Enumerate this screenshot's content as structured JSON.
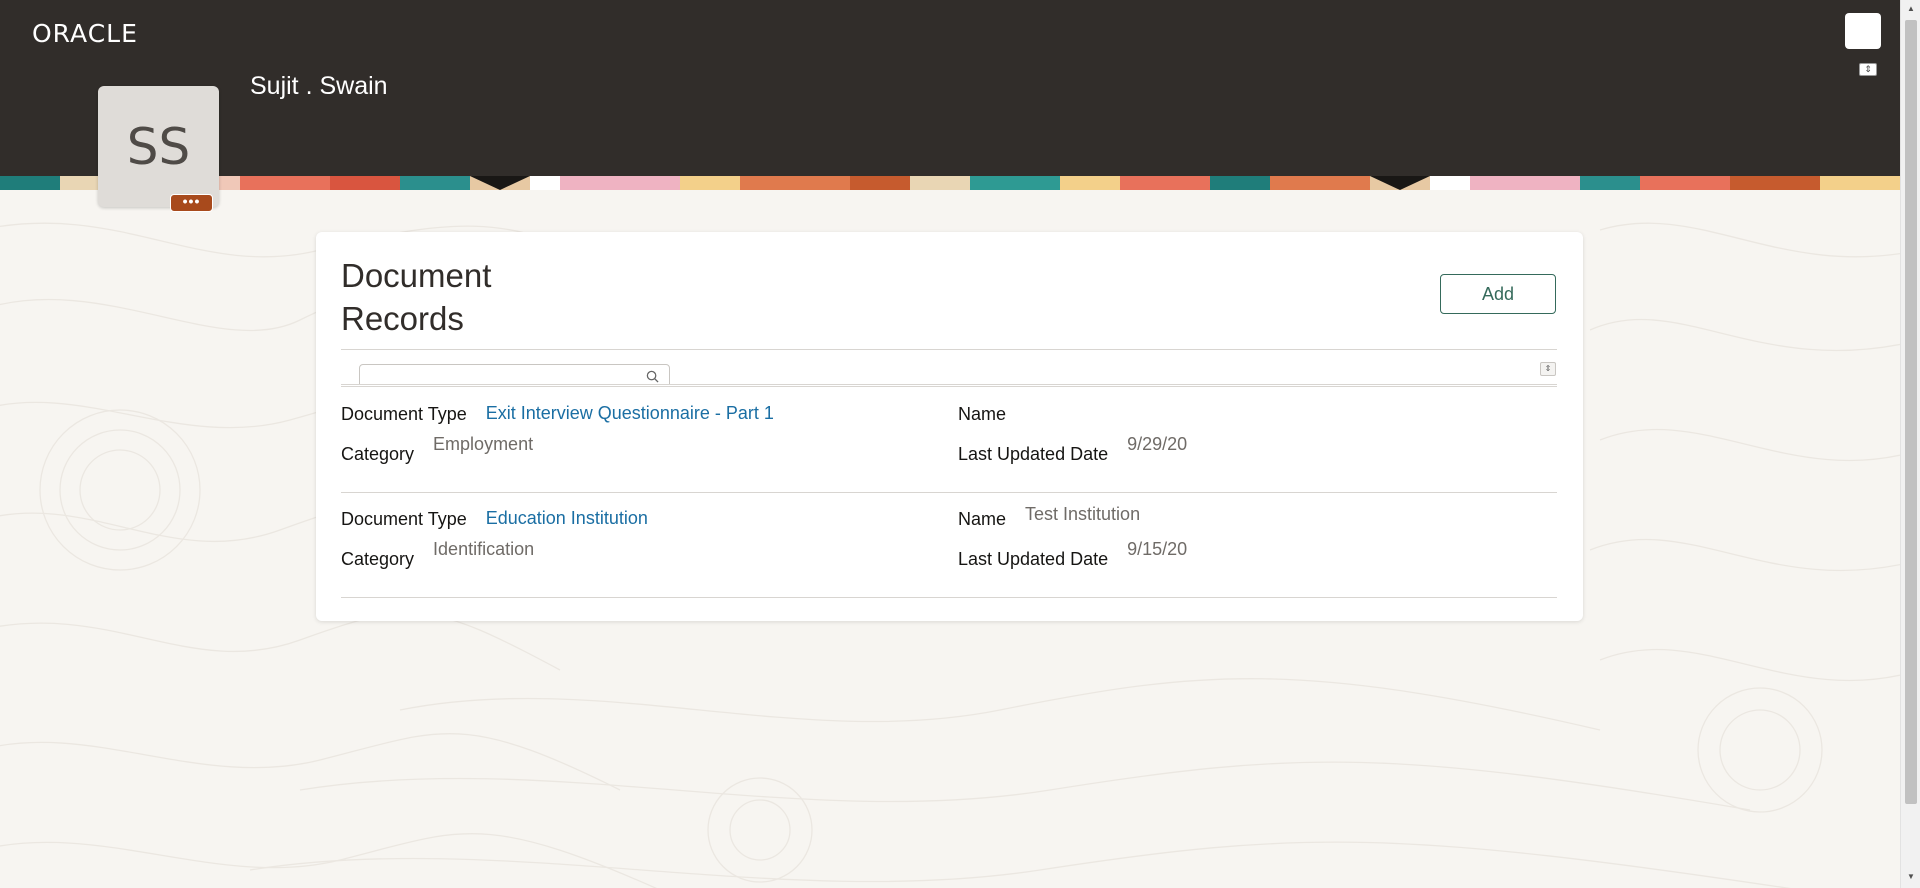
{
  "header": {
    "logo_text": "ORACLE",
    "person_name": "Sujit . Swain",
    "avatar_initials": "SS",
    "avatar_more_label": "•••"
  },
  "card": {
    "title_line1": "Document",
    "title_line2": "Records",
    "add_label": "Add"
  },
  "records": [
    {
      "document_type_label": "Document Type",
      "document_type": "Exit Interview Questionnaire - Part 1",
      "category_label": "Category",
      "category": "Employment",
      "name_label": "Name",
      "name": "",
      "last_updated_label": "Last Updated Date",
      "last_updated": "9/29/20"
    },
    {
      "document_type_label": "Document Type",
      "document_type": "Education Institution",
      "category_label": "Category",
      "category": "Identification",
      "name_label": "Name",
      "name": "Test Institution",
      "last_updated_label": "Last Updated Date",
      "last_updated": "9/15/20"
    }
  ],
  "colors": {
    "header_bg": "#312d2a",
    "link": "#1a6ea3",
    "add_button": "#356a5b",
    "avatar_badge": "#a84a1c"
  }
}
